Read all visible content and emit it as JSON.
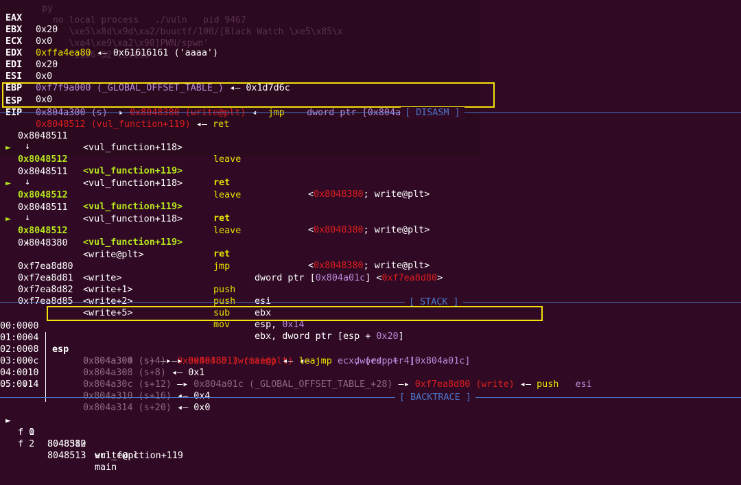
{
  "ghost_lines": [
    "    py",
    "      no local process   ./vuln   pid 9467",
    "         \\xe5\\x8d\\x9d\\xa2/buuctf/100/[Black Watch \\xe5\\x85\\x",
    "         \\xa4\\xe9\\xa2\\x98]PWN/spwn'",
    "          i386-32-little",
    "  1 #include <stdio.h>"
  ],
  "registers": [
    {
      "name": "EAX",
      "value": "0x20"
    },
    {
      "name": "EBX",
      "value": "0x0"
    },
    {
      "name": "ECX",
      "addr": "0xffa4ea80",
      "arrow": "◂—",
      "rest": "0x61616161 ('aaaa')"
    },
    {
      "name": "EDX",
      "value": "0x20"
    },
    {
      "name": "EDI",
      "value": "0x0"
    },
    {
      "name": "ESI",
      "addr": "0xf7f9a000",
      "sym": "(_GLOBAL_OFFSET_TABLE_)",
      "arrow": "◂—",
      "rest": "0x1d7d6c"
    },
    {
      "name": "EBP",
      "value": "0x0"
    },
    {
      "name": "ESP",
      "addr": "0x804a300",
      "sym": "(s)",
      "arrow1": "—▸",
      "target": "0x8048380",
      "tsym": "(write@plt)",
      "arrow2": "◂—",
      "ins": "jmp",
      "ops": "dword ptr [",
      "opaddr": "0x804a01c",
      "opclose": "]"
    },
    {
      "name": "EIP",
      "addr": "0x8048512",
      "sym": "(vul_function+119)",
      "arrow": "◂—",
      "ins": "ret"
    }
  ],
  "sections": {
    "disasm": "[ DISASM ]",
    "stack": "[ STACK ]",
    "backtrace": "[ BACKTRACE ]"
  },
  "disasm": [
    {
      "addr": "0x8048511",
      "sym": "<vul_function+118>",
      "ins": "leave",
      "ops": ""
    },
    {
      "addr": "0x8048512",
      "sym": "<vul_function+119>",
      "ins": "ret",
      "ops": "<",
      "opred": "0x8048380",
      "opend": "; write@plt>",
      "current": true
    },
    {
      "addr": "0x8048511",
      "sym": "<vul_function+118>",
      "ins": "leave",
      "ops": ""
    },
    {
      "addr": "0x8048512",
      "sym": "<vul_function+119>",
      "ins": "ret",
      "ops": "<",
      "opred": "0x8048380",
      "opend": "; write@plt>",
      "current": true
    },
    {
      "addr": "0x8048511",
      "sym": "<vul_function+118>",
      "ins": "leave",
      "ops": ""
    },
    {
      "addr": "0x8048512",
      "sym": "<vul_function+119>",
      "ins": "ret",
      "ops": "<",
      "opred": "0x8048380",
      "opend": "; write@plt>",
      "current": true
    },
    {
      "addr": "0x8048380",
      "sym": "<write@plt>",
      "ins": "jmp",
      "ops": "dword ptr [",
      "opaddr": "0x804a01c",
      "opmid": "] <",
      "opred": "0xf7ea8d80",
      "opend": ">"
    },
    {
      "addr": "0xf7ea8d80",
      "sym": "<write>",
      "ins": "push",
      "ops": "esi"
    },
    {
      "addr": "0xf7ea8d81",
      "sym": "<write+1>",
      "ins": "push",
      "ops": "ebx"
    },
    {
      "addr": "0xf7ea8d82",
      "sym": "<write+2>",
      "ins": "sub",
      "ops": "esp, ",
      "opnum": "0x14"
    },
    {
      "addr": "0xf7ea8d85",
      "sym": "<write+5>",
      "ins": "mov",
      "ops": "ebx, dword ptr [esp + ",
      "opnum": "0x20",
      "opend": "]"
    }
  ],
  "stack": [
    {
      "idx": "00:0000",
      "reg": "esp",
      "addr": "0x804a300",
      "sym": "(s)",
      "a1": "—▸",
      "target": "0x8048380",
      "tsym": "(write@plt)",
      "a2": "◂—",
      "ins": "jmp",
      "ops": "dword ptr [",
      "opaddr": "0x804a01c",
      "opend": "]"
    },
    {
      "idx": "01:0004",
      "addr": "0x804a304",
      "sym": "(s+4)",
      "a1": "—▸",
      "target": "0x8048513",
      "tsym": "(main)",
      "a2": "◂—",
      "ins": "lea",
      "ops": "ecx, [esp + ",
      "opnum": "4",
      "opend": "]"
    },
    {
      "idx": "02:0008",
      "addr": "0x804a308",
      "sym": "(s+8)",
      "a2": "◂—",
      "rest": "0x1"
    },
    {
      "idx": "03:000c",
      "addr": "0x804a30c",
      "sym": "(s+12)",
      "a1": "—▸",
      "mid": "0x804a01c (_GLOBAL_OFFSET_TABLE_+28)",
      "a3": "—▸",
      "target": "0xf7ea8d80",
      "tsym": "(write)",
      "a2": "◂—",
      "ins": "push",
      "ops": "esi"
    },
    {
      "idx": "04:0010",
      "addr": "0x804a310",
      "sym": "(s+16)",
      "a2": "◂—",
      "rest": "0x4"
    },
    {
      "idx": "05:0014",
      "addr": "0x804a314",
      "sym": "(s+20)",
      "a2": "◂—",
      "rest": "0x0"
    }
  ],
  "stack_more": "... ↓",
  "backtrace": [
    {
      "marker": "►",
      "frame": "f 0",
      "addr": "8048512",
      "fn": "vul_function+119"
    },
    {
      "marker": "",
      "frame": "f 1",
      "addr": "8048380",
      "fn": "write@plt"
    },
    {
      "marker": "",
      "frame": "f 2",
      "addr": "8048513",
      "fn": "main"
    }
  ],
  "colors": {
    "bg": "#300a24",
    "yellow": "#e8e000",
    "red": "#dd1e1e",
    "purple": "#b98cdc",
    "green": "#b5e61d",
    "separator": "#4c75c9",
    "highlight": "#f4e20a"
  }
}
